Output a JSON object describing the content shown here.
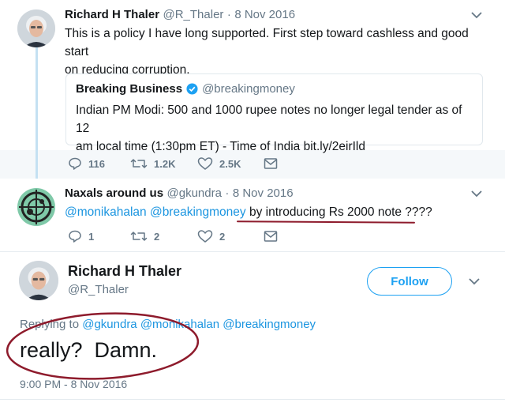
{
  "tweet1": {
    "name": "Richard H Thaler",
    "handle": "@R_Thaler",
    "separator": "·",
    "date": "8 Nov 2016",
    "text_line1": "This is a policy I have long supported. First step toward cashless and good start",
    "text_line2": "on reducing corruption.",
    "quote": {
      "name": "Breaking Business",
      "handle": "@breakingmoney",
      "text_line1": "Indian PM Modi: 500 and 1000 rupee notes no longer legal tender as of 12",
      "text_line2_prefix": "am local time (1:30pm ET) - Time of India ",
      "text_line2_link": "bit.ly/2eirIld"
    },
    "actions": {
      "replies": "116",
      "retweets": "1.2K",
      "likes": "2.5K"
    }
  },
  "tweet2": {
    "name": "Naxals around us",
    "handle": "@gkundra",
    "separator": "·",
    "date": "8 Nov 2016",
    "mention1": "@monikahalan",
    "mention2": "@breakingmoney",
    "text": "by introducing Rs 2000 note ????",
    "actions": {
      "replies": "1",
      "retweets": "2",
      "likes": "2"
    }
  },
  "main": {
    "name": "Richard H Thaler",
    "handle": "@R_Thaler",
    "follow_label": "Follow",
    "replying_prefix": "Replying to",
    "replying_to": "@gkundra @monikahalan @breakingmoney",
    "text": "really?  Damn.",
    "timestamp": "9:00 PM - 8 Nov 2016"
  },
  "colors": {
    "link": "#1b95e0",
    "annotation": "#8e1b2c",
    "verified": "#1da1f2"
  },
  "icons": [
    "reply-icon",
    "retweet-icon",
    "like-icon",
    "message-icon",
    "chevron-down-icon",
    "verified-badge-icon"
  ]
}
